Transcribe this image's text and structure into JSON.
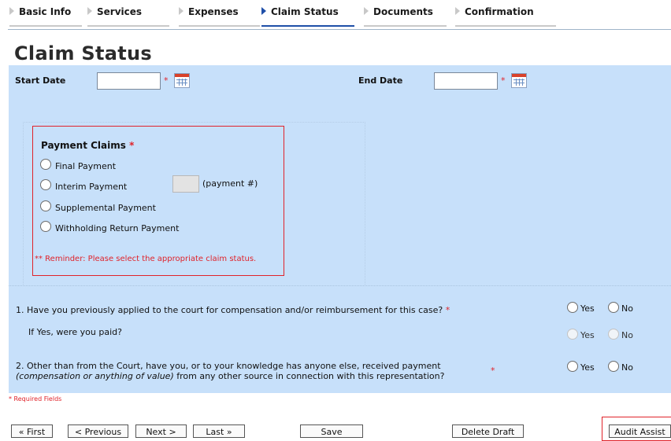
{
  "tabs": [
    {
      "label": "Basic Info",
      "active": false
    },
    {
      "label": "Services",
      "active": false
    },
    {
      "label": "Expenses",
      "active": false
    },
    {
      "label": "Claim Status",
      "active": true
    },
    {
      "label": "Documents",
      "active": false
    },
    {
      "label": "Confirmation",
      "active": false
    }
  ],
  "page_title": "Claim Status",
  "dates": {
    "start_label": "Start Date",
    "start_value": "",
    "end_label": "End Date",
    "end_value": "",
    "required_mark": "*"
  },
  "payment_claims": {
    "label": "Payment Claims",
    "required_mark": "*",
    "options": [
      "Final Payment",
      "Interim Payment",
      "Supplemental Payment",
      "Withholding Return Payment"
    ],
    "payment_number_value": "",
    "payment_number_hint": "(payment #)",
    "reminder": "** Reminder: Please select the appropriate claim status."
  },
  "questions": {
    "q1": "1. Have you previously applied to the court for compensation and/or reimbursement for this case?",
    "q1_required": "*",
    "q1_sub": "If Yes, were you paid?",
    "q2_line1": "2. Other than from the Court, have you, or to your knowledge has anyone else, received payment",
    "q2_line2_italic": "(compensation or anything of value)",
    "q2_line2_rest": " from any other source in connection with this representation?",
    "q2_required": "*",
    "yes": "Yes",
    "no": "No"
  },
  "required_note": "* Required Fields",
  "buttons": {
    "first": "« First",
    "previous": "< Previous",
    "next": "Next >",
    "last": "Last »",
    "save": "Save",
    "delete_draft": "Delete Draft",
    "audit_assist": "Audit Assist"
  },
  "colors": {
    "panel_bg": "#c7e0fa",
    "required_red": "#e0232a",
    "active_tab": "#1f4fa8"
  }
}
